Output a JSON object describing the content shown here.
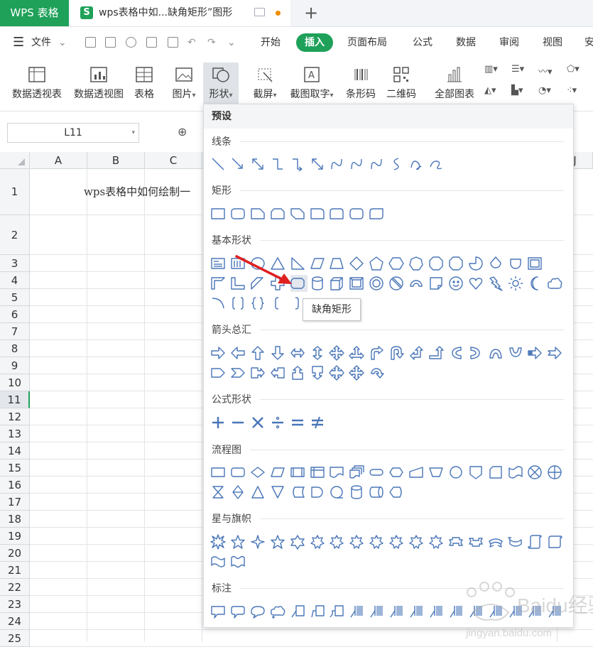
{
  "tabs": {
    "app": "WPS 表格",
    "doc": "wps表格中如...缺角矩形”图形",
    "doc_icon": "S",
    "new_tab": "+"
  },
  "menu": {
    "file": "文件",
    "items": [
      "开始",
      "插入",
      "页面布局",
      "公式",
      "数据",
      "审阅",
      "视图",
      "安"
    ],
    "active": "插入"
  },
  "ribbon": {
    "buttons": [
      {
        "label": "数据透视表",
        "icon": "pivot-table-icon"
      },
      {
        "label": "数据透视图",
        "icon": "pivot-chart-icon"
      },
      {
        "label": "表格",
        "icon": "table-icon"
      },
      {
        "label": "图片",
        "icon": "picture-icon"
      },
      {
        "label": "形状",
        "icon": "shape-icon"
      },
      {
        "label": "截屏",
        "icon": "screenshot-icon"
      },
      {
        "label": "截图取字",
        "icon": "ocr-icon"
      },
      {
        "label": "条形码",
        "icon": "barcode-icon"
      },
      {
        "label": "二维码",
        "icon": "qrcode-icon"
      },
      {
        "label": "全部图表",
        "icon": "all-charts-icon"
      }
    ]
  },
  "namebox": "L11",
  "columns": [
    "A",
    "B",
    "C",
    "J"
  ],
  "rows": [
    "1",
    "2",
    "3",
    "4",
    "5",
    "6",
    "7",
    "8",
    "9",
    "10",
    "11",
    "12",
    "13",
    "14",
    "15",
    "16",
    "17",
    "18",
    "19",
    "20",
    "21",
    "22",
    "23",
    "24",
    "25"
  ],
  "active_row": "11",
  "cell_a1": "wps表格中如何绘制一",
  "dropdown": {
    "header": "预设",
    "sections": [
      "线条",
      "矩形",
      "基本形状",
      "箭头总汇",
      "公式形状",
      "流程图",
      "星与旗帜",
      "标注"
    ],
    "tooltip": "缺角矩形"
  },
  "colors": {
    "accent": "#1fa15a",
    "shape_stroke": "#4a76b8",
    "arrow": "#e02020"
  },
  "watermark": {
    "brand": "Baidu经验",
    "url": "jingyan.baidu.com"
  }
}
